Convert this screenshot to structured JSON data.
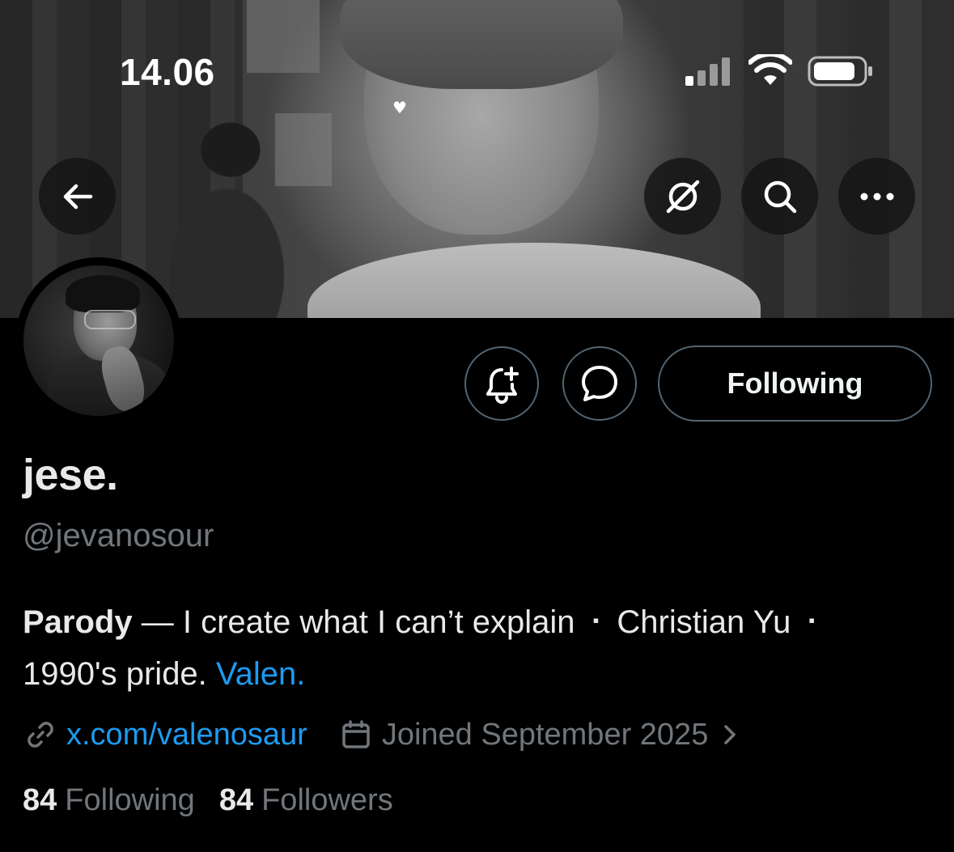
{
  "status_bar": {
    "time": "14.06"
  },
  "banner": {
    "heart": "♥"
  },
  "header_buttons": {
    "back_icon": "arrow-left-icon",
    "grok_icon": "grok-icon",
    "search_icon": "search-icon",
    "more_icon": "more-horizontal-icon"
  },
  "profile": {
    "display_name": "jese.",
    "handle": "@jevanosour",
    "bio": {
      "label": "Parody",
      "dash": " — ",
      "text1": "I create what I can’t explain",
      "sep": "▪",
      "text2": "Christian Yu",
      "text3": "1990's pride.",
      "link": "Valen."
    },
    "website": "x.com/valenosaur",
    "joined": "Joined September 2025",
    "following_count": "84",
    "following_label": "Following",
    "followers_count": "84",
    "followers_label": "Followers"
  },
  "actions": {
    "notify_icon": "bell-plus-icon",
    "message_icon": "message-icon",
    "following_button": "Following"
  },
  "colors": {
    "background": "#000000",
    "link": "#1d9bf0",
    "secondary_text": "#71767b",
    "primary_text": "#e7e9ea",
    "border": "#536471"
  }
}
